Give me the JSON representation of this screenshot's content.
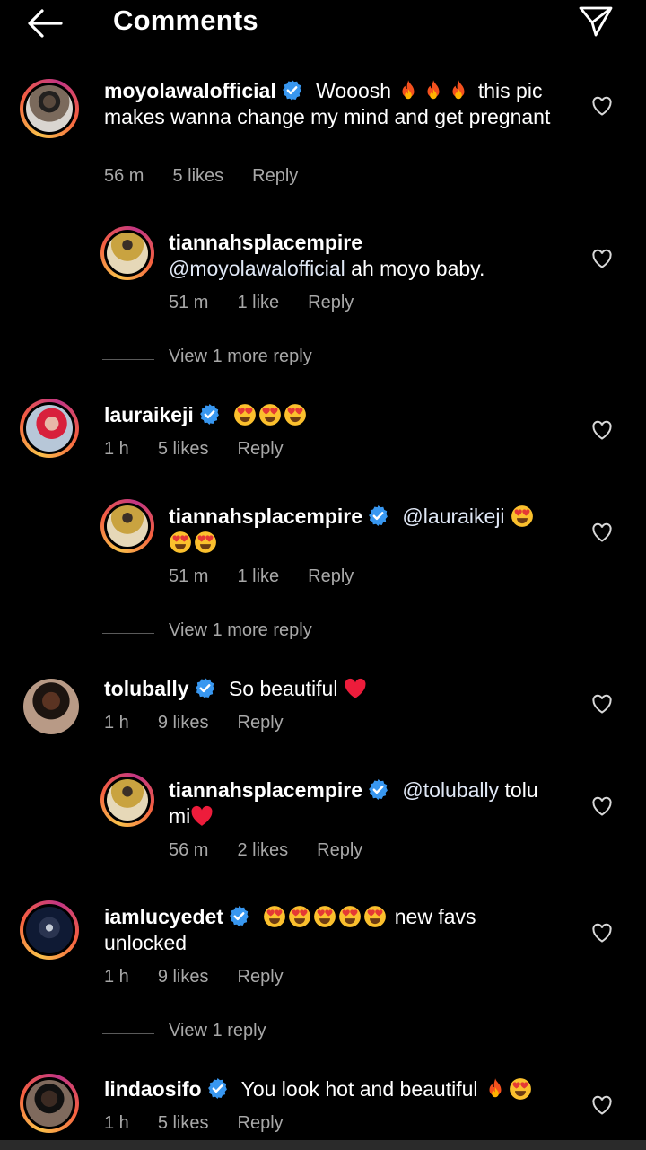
{
  "header": {
    "title": "Comments"
  },
  "colors": {
    "background": "#000000",
    "text": "#ffffff",
    "muted": "#a8a8a8",
    "verified": "#3897f0",
    "heart": "#ed1c3b"
  },
  "comments": [
    {
      "user": "moyolawalofficial",
      "verified": true,
      "text_before": " Wooosh ",
      "emoji_mid": "fire x3",
      "text_after": " this pic makes wanna change my mind and get pregnant",
      "time": "56 m",
      "likes": "5 likes",
      "reply": "Reply",
      "replies": [
        {
          "user": "tiannahsplacempire",
          "mention": "@moyolawalofficial",
          "text": " ah moyo baby.",
          "time": "51 m",
          "likes": "1 like",
          "reply": "Reply"
        }
      ],
      "view_more": "View 1 more reply"
    },
    {
      "user": "lauraikeji",
      "verified": true,
      "emoji": "heart-eyes x3",
      "time": "1 h",
      "likes": "5 likes",
      "reply": "Reply",
      "replies": [
        {
          "user": "tiannahsplacempire",
          "verified": true,
          "mention": "@lauraikeji",
          "emoji": "heart-eyes x3",
          "time": "51 m",
          "likes": "1 like",
          "reply": "Reply"
        }
      ],
      "view_more": "View 1 more reply"
    },
    {
      "user": "tolubally",
      "verified": true,
      "text": "So beautiful",
      "emoji": "red-heart",
      "time": "1 h",
      "likes": "9 likes",
      "reply": "Reply",
      "replies": [
        {
          "user": "tiannahsplacempire",
          "verified": true,
          "mention": "@tolubally",
          "text": " tolu mi",
          "emoji": "red-heart",
          "time": "56 m",
          "likes": "2 likes",
          "reply": "Reply"
        }
      ]
    },
    {
      "user": "iamlucyedet",
      "verified": true,
      "emoji": "heart-eyes x5",
      "text": " new favs unlocked",
      "time": "1 h",
      "likes": "9 likes",
      "reply": "Reply",
      "view_more": "View 1 reply"
    },
    {
      "user": "lindaosifo",
      "verified": true,
      "text": "You look hot and beautiful ",
      "emoji": "fire, heart-eyes",
      "time": "1 h",
      "likes": "5 likes",
      "reply": "Reply"
    }
  ]
}
